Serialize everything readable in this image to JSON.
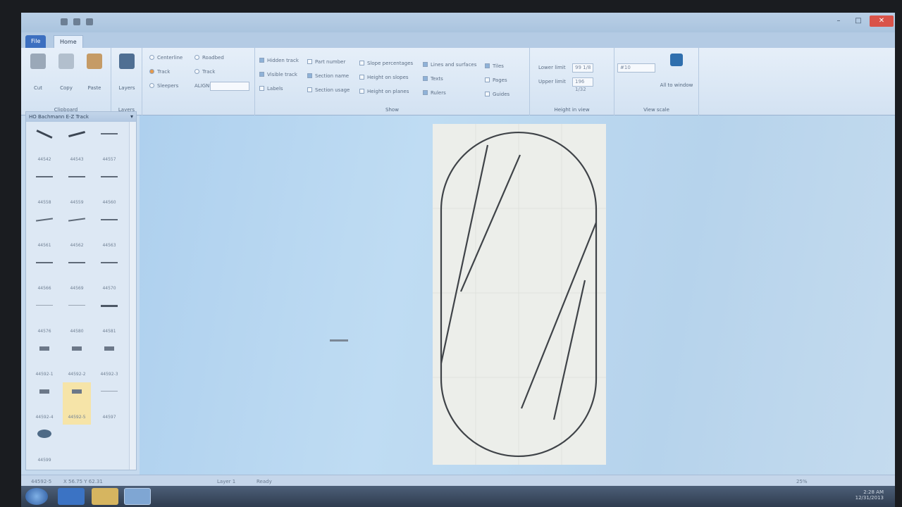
{
  "window": {
    "title": "",
    "controls": {
      "minimize": "–",
      "maximize": "□",
      "close": "✕"
    }
  },
  "ribbon": {
    "tabs": [
      {
        "label": "File"
      },
      {
        "label": "Home"
      }
    ],
    "clipboard": {
      "cut": "Cut",
      "copy": "Copy",
      "paste": "Paste",
      "group": "Clipboard"
    },
    "layers": {
      "button": "Layers",
      "group": "Layers"
    },
    "mode_options": [
      {
        "label": "Centerline",
        "kind": "radio",
        "on": false
      },
      {
        "label": "Track",
        "kind": "radio",
        "on": true
      },
      {
        "label": "Sleepers",
        "kind": "radio",
        "on": false
      },
      {
        "label": "Roadbed",
        "kind": "radio",
        "on": false
      },
      {
        "label": "Track",
        "kind": "radio",
        "on": false
      },
      {
        "label": "ALIGN",
        "kind": "text",
        "on": false
      }
    ],
    "show_options": [
      {
        "label": "Hidden track",
        "on": true
      },
      {
        "label": "Visible track",
        "on": true
      },
      {
        "label": "Labels",
        "on": false
      },
      {
        "label": "Part number",
        "on": false
      },
      {
        "label": "Section name",
        "on": true
      },
      {
        "label": "Section usage",
        "on": false
      },
      {
        "label": "Slope percentages",
        "on": false
      },
      {
        "label": "Height on slopes",
        "on": false
      },
      {
        "label": "Height on planes",
        "on": false
      },
      {
        "label": "Lines and surfaces",
        "on": true
      },
      {
        "label": "Texts",
        "on": true
      },
      {
        "label": "Rulers",
        "on": true
      },
      {
        "label": "Tiles",
        "on": true
      },
      {
        "label": "Pages",
        "on": false
      },
      {
        "label": "Guides",
        "on": false
      }
    ],
    "show_group": "Show",
    "height": {
      "lower_label": "Lower limit",
      "lower_value": "99 1/8",
      "upper_label": "Upper limit",
      "upper_value": "196 1/32",
      "scale_value": "#10",
      "group": "Height in view"
    },
    "zoom": {
      "button": "All to window",
      "group": "View scale"
    }
  },
  "panel": {
    "title": "HO Bachmann E-Z Track",
    "items": [
      {
        "label": "44542",
        "shape": "cross"
      },
      {
        "label": "44543",
        "shape": "switch"
      },
      {
        "label": "44557",
        "shape": "line"
      },
      {
        "label": "44558",
        "shape": "line"
      },
      {
        "label": "44559",
        "shape": "line"
      },
      {
        "label": "44560",
        "shape": "line"
      },
      {
        "label": "44561",
        "shape": "curve"
      },
      {
        "label": "44562",
        "shape": "curve"
      },
      {
        "label": "44563",
        "shape": "line"
      },
      {
        "label": "44566",
        "shape": "line"
      },
      {
        "label": "44569",
        "shape": "line"
      },
      {
        "label": "44570",
        "shape": "line"
      },
      {
        "label": "44576",
        "shape": "thin"
      },
      {
        "label": "44580",
        "shape": "thin"
      },
      {
        "label": "44581",
        "shape": "thick"
      },
      {
        "label": "44592-1",
        "shape": "block"
      },
      {
        "label": "44592-2",
        "shape": "block"
      },
      {
        "label": "44592-3",
        "shape": "block"
      },
      {
        "label": "44592-4",
        "shape": "block"
      },
      {
        "label": "44592-5",
        "shape": "block",
        "selected": true
      },
      {
        "label": "44597",
        "shape": "thin"
      },
      {
        "label": "44599",
        "shape": "round"
      }
    ]
  },
  "status": {
    "left": "44592-5",
    "coords": "X 56.75 Y 62.31",
    "layer": "Layer 1",
    "state": "Ready",
    "zoom": "25%"
  },
  "taskbar": {
    "time": "2:28 AM",
    "date": "12/31/2013"
  },
  "colors": {
    "ribbon": "#dfe9f6",
    "workspace": "#b6d3ec",
    "sheet": "#eceeea",
    "track": "#3f4348"
  }
}
